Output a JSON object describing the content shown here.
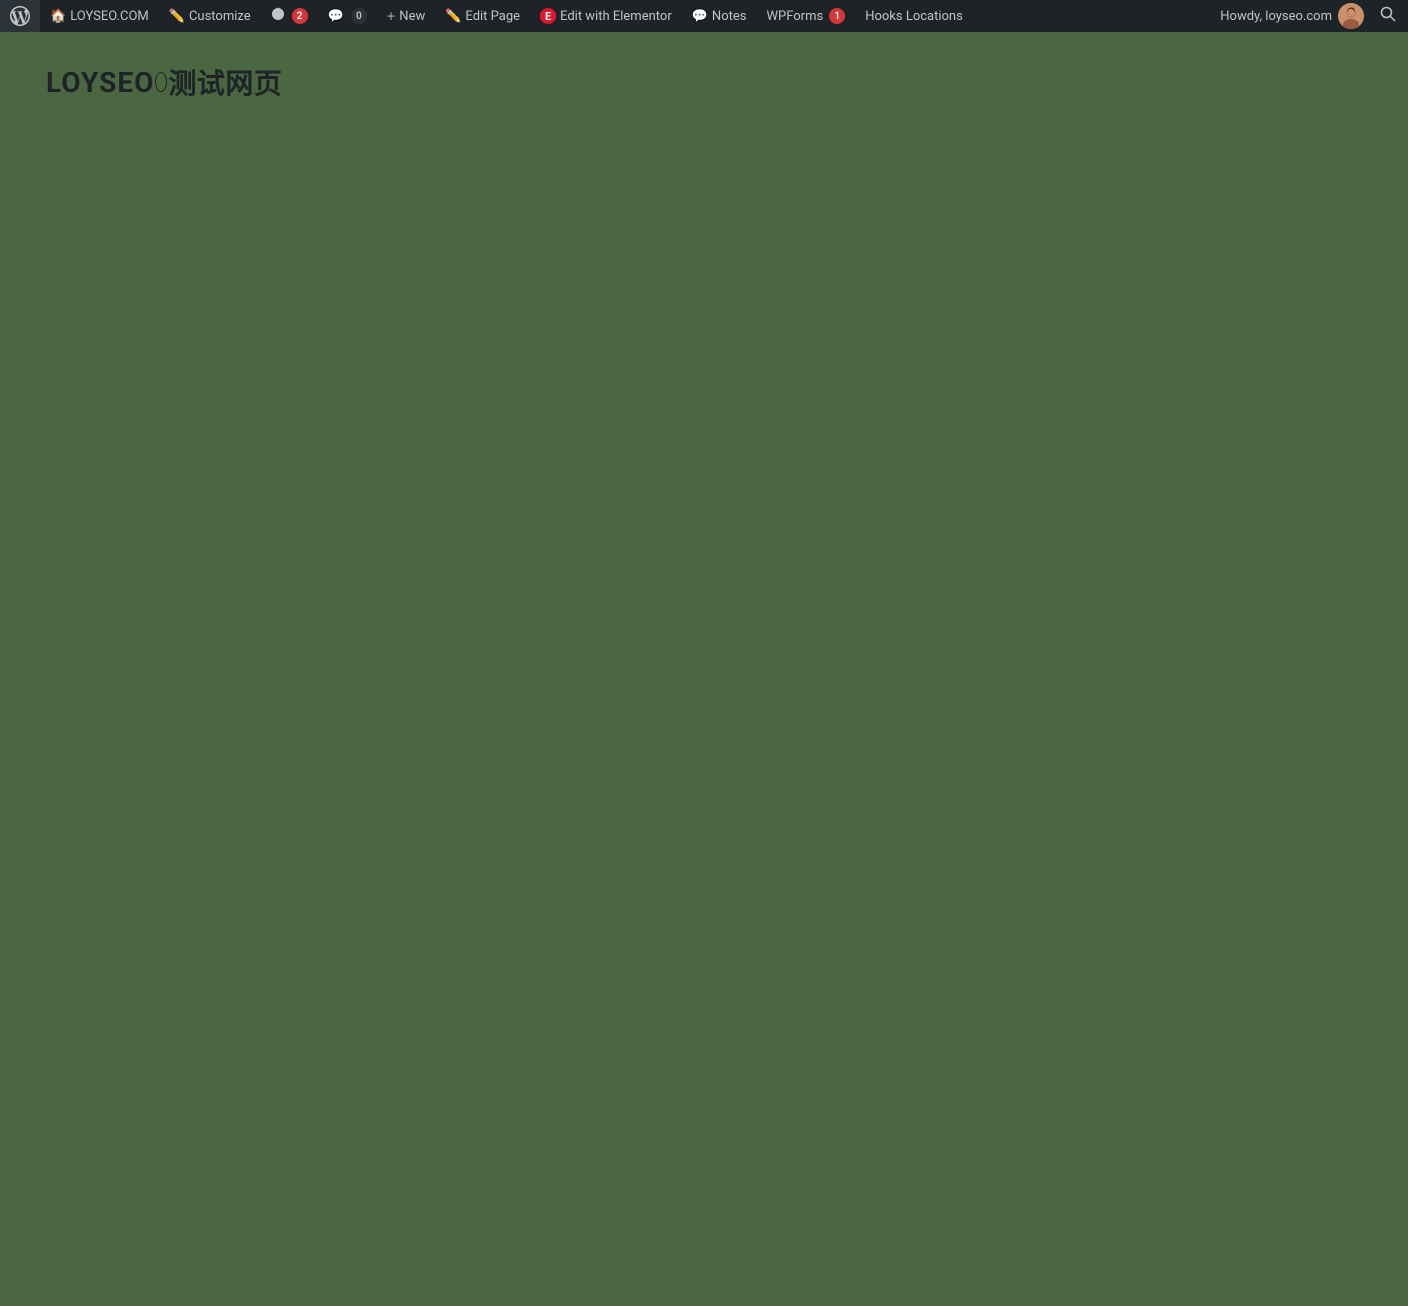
{
  "adminbar": {
    "wp_logo_title": "WordPress",
    "site_name": "LOYSEO.COM",
    "customize_label": "Customize",
    "updates_label": "2",
    "comments_label": "0",
    "new_label": "New",
    "edit_page_label": "Edit Page",
    "edit_elementor_label": "Edit with Elementor",
    "notes_label": "Notes",
    "wpforms_label": "WPForms",
    "wpforms_badge": "1",
    "hooks_label": "Hooks Locations",
    "howdy_text": "Howdy, loyseo.com",
    "search_title": "Search"
  },
  "page": {
    "site_title_latin": "LOYSEO",
    "site_title_chinese": "测试网页",
    "background_color": "#4a6741"
  }
}
